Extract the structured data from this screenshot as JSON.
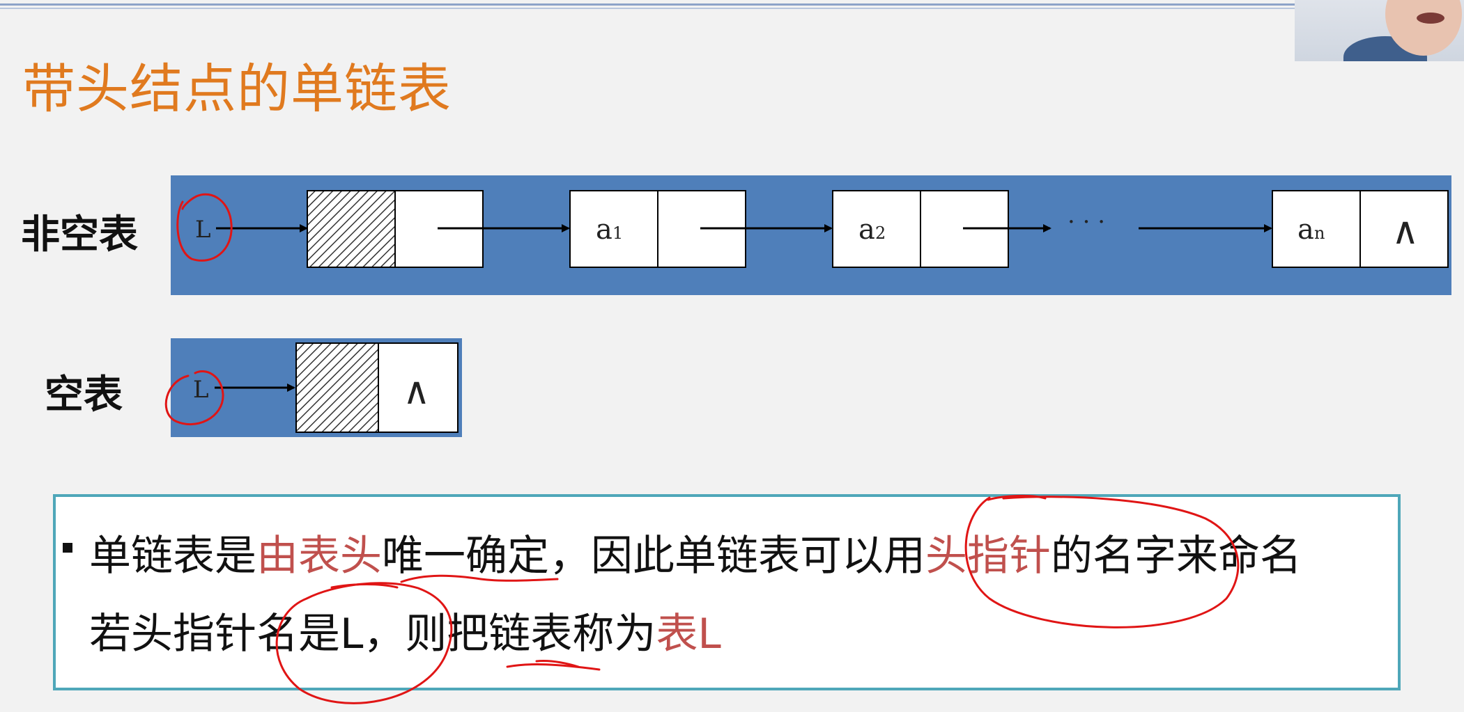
{
  "slide": {
    "title": "带头结点的单链表",
    "label_nonempty": "非空表",
    "label_empty": "空表"
  },
  "diagram": {
    "head_pointer": "L",
    "node_a1": "a",
    "node_a1_sub": "1",
    "node_a2": "a",
    "node_a2_sub": "2",
    "node_an": "a",
    "node_an_sub": "n",
    "ellipsis": "· · ·",
    "null_symbol": "∧",
    "colors": {
      "band": "#4f7fba",
      "node": "#ffffff"
    }
  },
  "text": {
    "line1": [
      {
        "t": "单链表是",
        "hl": false
      },
      {
        "t": "由表头",
        "hl": true
      },
      {
        "t": "唯一确定，因此单链表可以用",
        "hl": false
      },
      {
        "t": "头指针",
        "hl": true
      },
      {
        "t": "的名字来命名",
        "hl": false
      }
    ],
    "line2": [
      {
        "t": "若头指针名是L，则把链表称为",
        "hl": false
      },
      {
        "t": "表L",
        "hl": true
      }
    ]
  }
}
